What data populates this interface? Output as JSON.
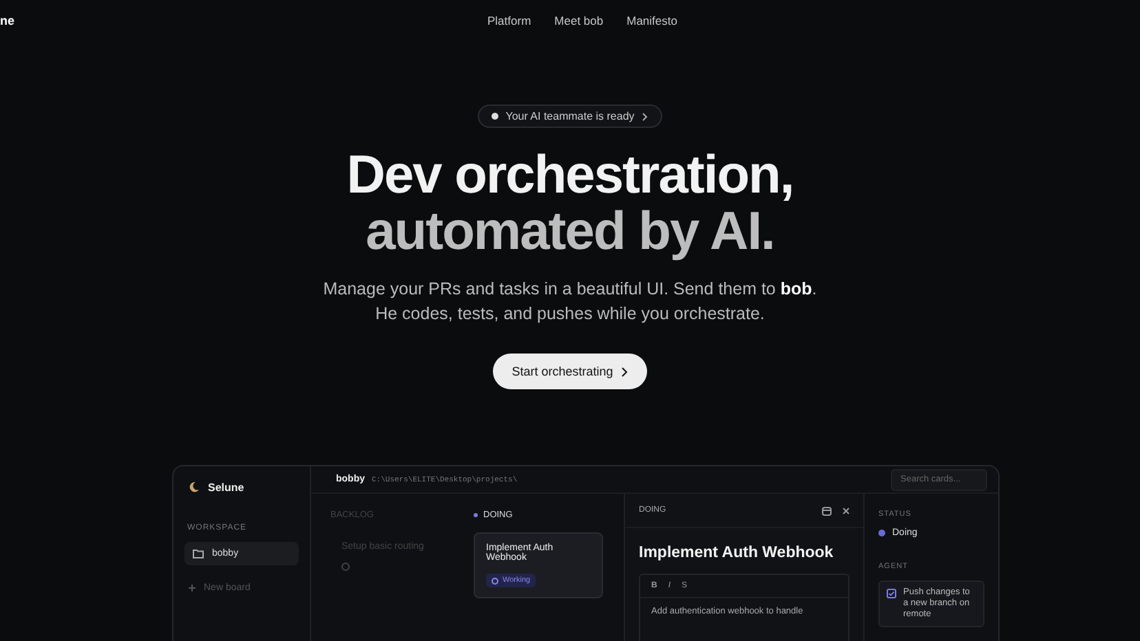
{
  "nav": {
    "logo": "ne",
    "links": [
      "Platform",
      "Meet bob",
      "Manifesto"
    ]
  },
  "hero": {
    "badge": "Your AI teammate is ready",
    "title_lines": [
      "Dev orchestration,",
      "automated by AI."
    ],
    "subtitle_lines": [
      "Manage your PRs and tasks in a beautiful UI. Send them to **bob**.",
      "He codes, tests, and pushes while you orchestrate."
    ],
    "cta": "Start orchestrating"
  },
  "app": {
    "brand": "Selune",
    "section": "WORKSPACE",
    "workspaces": [
      {
        "label": "bobby",
        "selected": true
      }
    ],
    "new_board": "New board",
    "project": "bobby",
    "path": "C:\\Users\\ELITE\\Desktop\\projects\\",
    "search": {
      "placeholder": "Search cards..."
    },
    "columns": [
      {
        "title": "BACKLOG",
        "active": false,
        "cards": [
          {
            "title": "Setup basic routing",
            "selected": false
          }
        ]
      },
      {
        "title": "DOING",
        "active": true,
        "cards": [
          {
            "title": "Implement Auth Webhook",
            "selected": true,
            "tag": "Working"
          }
        ]
      }
    ],
    "detail": {
      "column": "DOING",
      "title": "Implement Auth Webhook",
      "toolbar": [
        "B",
        "I",
        "S"
      ],
      "body": "Add authentication webhook to handle"
    },
    "status": {
      "heading": "STATUS",
      "value": "Doing",
      "color": "#6b6bd6"
    },
    "agent": {
      "heading": "AGENT",
      "task": "Push changes to a new branch on remote"
    }
  }
}
